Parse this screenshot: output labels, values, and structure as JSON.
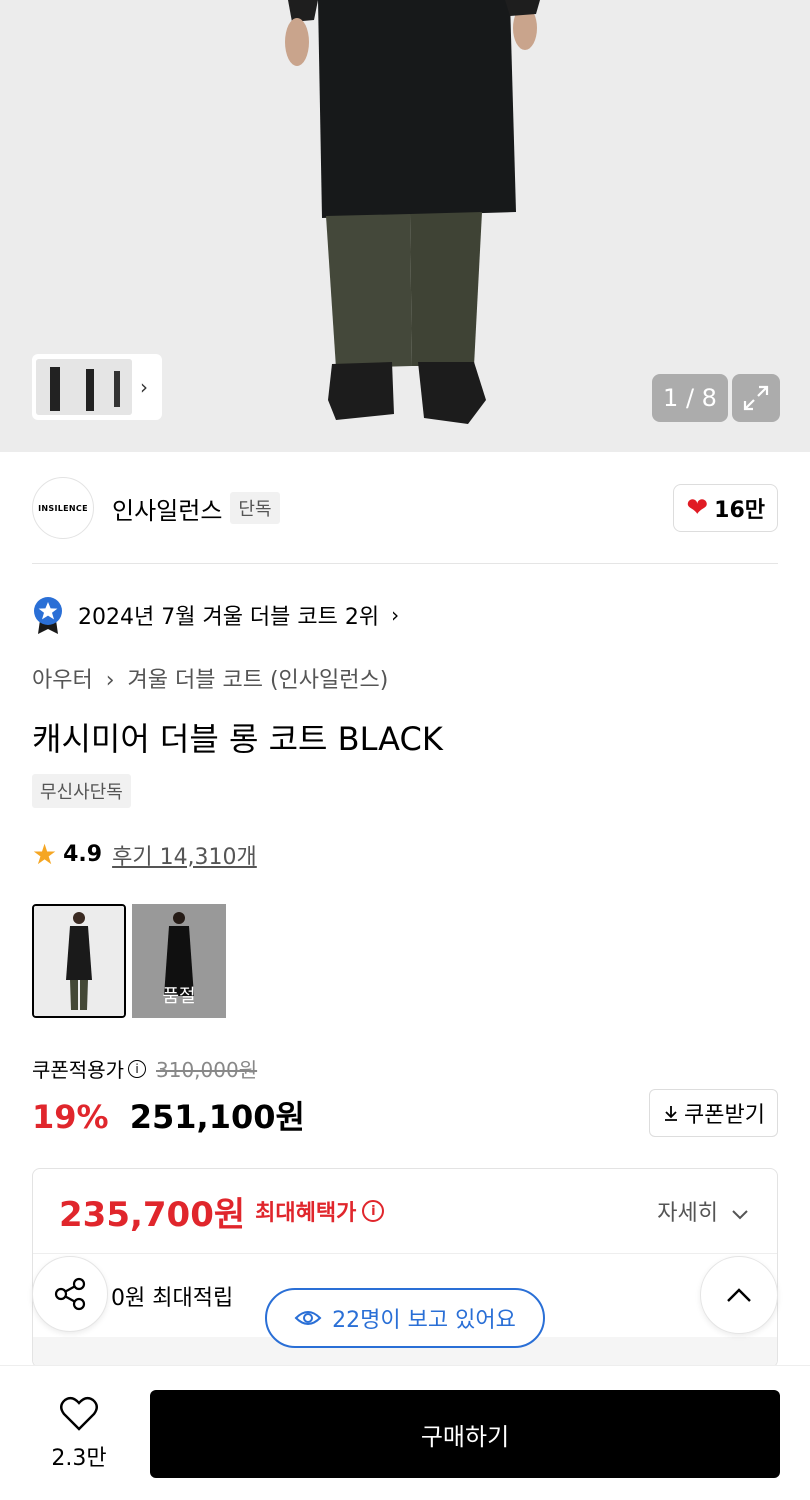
{
  "gallery": {
    "counter": "1 / 8",
    "expand_icon": "expand-icon",
    "chevron_icon": "chevron-right-icon"
  },
  "brand": {
    "logo_text": "INSILENCE",
    "name": "인사일런스",
    "tag": "단독",
    "likes": "16만"
  },
  "ranking": {
    "text": "2024년 7월 겨울 더블 코트 2위",
    "arrow": "›"
  },
  "breadcrumb": {
    "category": "아우터",
    "separator": "›",
    "sub": "겨울 더블 코트 (인사일런스)"
  },
  "product": {
    "title": "캐시미어 더블 롱 코트 BLACK",
    "tag": "무신사단독"
  },
  "rating": {
    "score": "4.9",
    "reviews": "후기 14,310개"
  },
  "options": [
    {
      "label": "",
      "sold_out": false
    },
    {
      "label": "품절",
      "sold_out": true
    }
  ],
  "price": {
    "coupon_label": "쿠폰적용가",
    "info_glyph": "i",
    "original": "310,000원",
    "discount": "19%",
    "final": "251,100원",
    "coupon_button": "쿠폰받기"
  },
  "benefit": {
    "max_amount": "235,700원",
    "max_label": "최대혜택가",
    "detail": "자세히",
    "points": "0원 최대적립"
  },
  "floating": {
    "viewers": "22명이 보고 있어요"
  },
  "bottom_bar": {
    "wish_count": "2.3만",
    "buy_label": "구매하기"
  },
  "colors": {
    "accent_red": "#e0262c",
    "accent_blue": "#2a6fd6",
    "buy_button": "#000000"
  }
}
